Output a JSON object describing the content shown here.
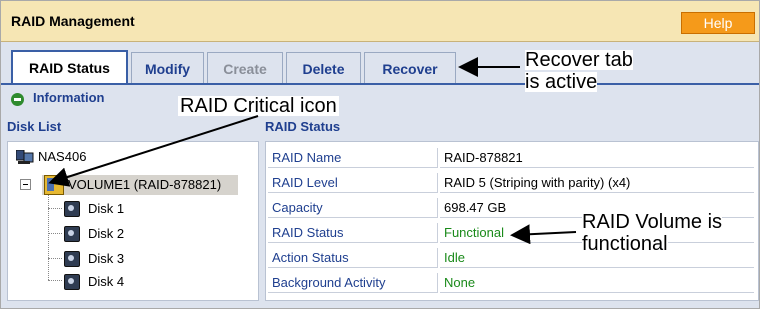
{
  "app": {
    "title": "RAID Management",
    "help_label": "Help"
  },
  "tabs": [
    {
      "label": "RAID Status",
      "state": "active"
    },
    {
      "label": "Modify",
      "state": "normal"
    },
    {
      "label": "Create",
      "state": "disabled"
    },
    {
      "label": "Delete",
      "state": "normal"
    },
    {
      "label": "Recover",
      "state": "normal"
    }
  ],
  "info": {
    "label": "Information",
    "icon": "green-circle-icon"
  },
  "disk_list": {
    "header": "Disk List",
    "root": "NAS406",
    "volume": "VOLUME1 (RAID-878821)",
    "disks": [
      "Disk 1",
      "Disk 2",
      "Disk 3",
      "Disk 4"
    ]
  },
  "raid_status": {
    "header": "RAID Status",
    "rows": [
      {
        "key": "RAID Name",
        "value": "RAID-878821"
      },
      {
        "key": "RAID Level",
        "value": "RAID 5 (Striping with parity) (x4)"
      },
      {
        "key": "Capacity",
        "value": "698.47 GB"
      },
      {
        "key": "RAID Status",
        "value": "Functional"
      },
      {
        "key": "Action Status",
        "value": "Idle"
      },
      {
        "key": "Background Activity",
        "value": "None"
      }
    ]
  },
  "annotations": {
    "recover_tab": [
      "Recover tab",
      "is active"
    ],
    "critical_icon": "RAID Critical icon",
    "volume_functional": [
      "RAID Volume is",
      "functional"
    ]
  },
  "colors": {
    "accent": "#1f3f8f",
    "help_button": "#f59a1a",
    "title_bar": "#f6e6b4",
    "status_ok": "#1a8a1a"
  }
}
